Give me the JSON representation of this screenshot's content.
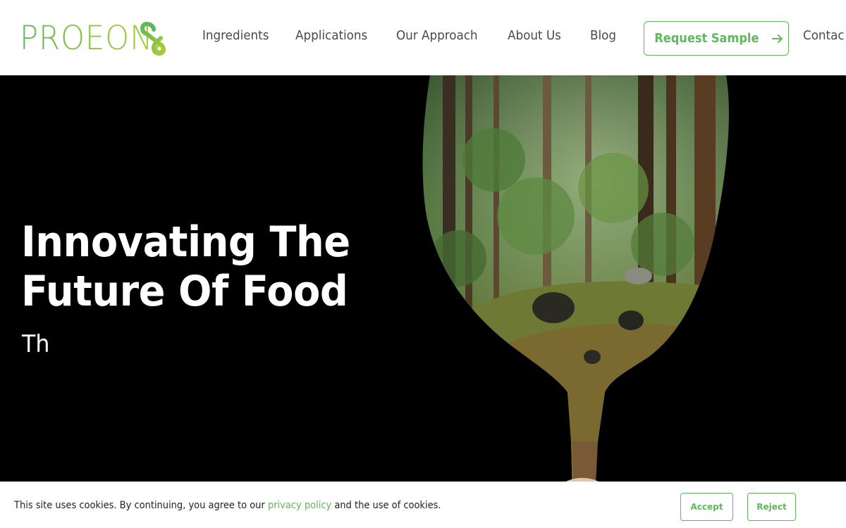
{
  "header": {
    "logo_text": "PROEON",
    "nav": [
      {
        "label": "Ingredients"
      },
      {
        "label": "Applications"
      },
      {
        "label": "Our Approach"
      },
      {
        "label": "About Us"
      },
      {
        "label": "Blog"
      }
    ],
    "cta_label": "Request Sample",
    "contact_label": "Contac"
  },
  "hero": {
    "title_line1": "Innovating The",
    "title_line2": "Future Of Food",
    "subtitle": "Th"
  },
  "cookie": {
    "text_before": "This site uses cookies. By continuing, you agree to our ",
    "link": "privacy policy",
    "text_after": " and the use of cookies.",
    "accept": "Accept",
    "reject": "Reject"
  },
  "colors": {
    "brand_green": "#5fb85c",
    "brand_lime": "#a8cc3a",
    "nav_text": "#4a4a4a"
  }
}
